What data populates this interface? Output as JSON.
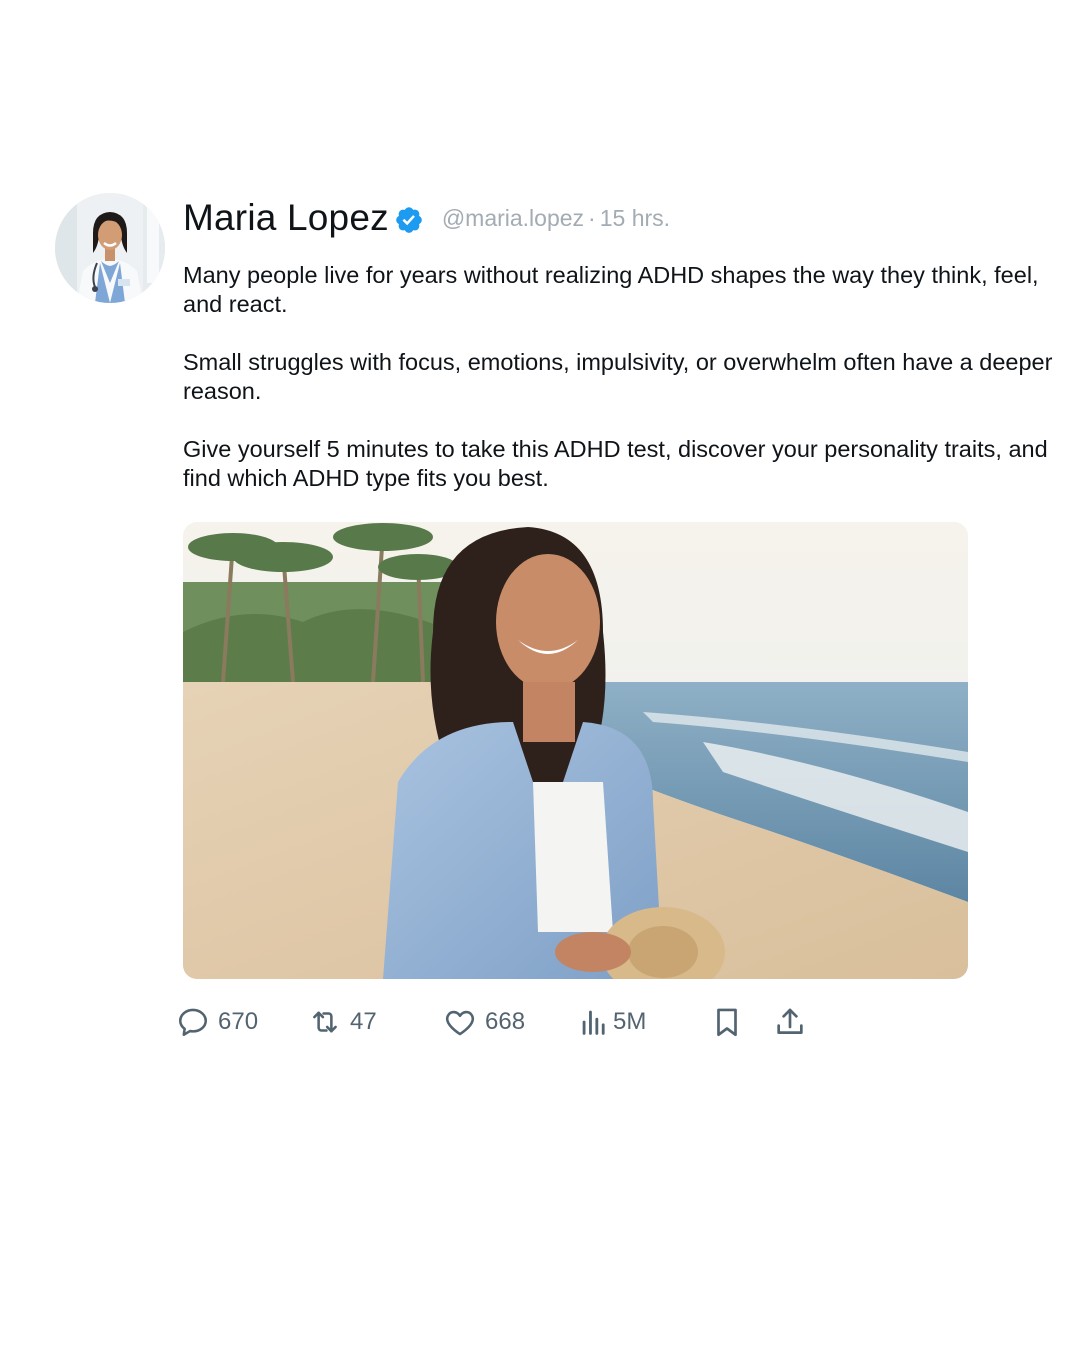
{
  "post": {
    "author_name": "Maria Lopez",
    "handle": "@maria.lopez",
    "separator": "·",
    "time": "15 hrs.",
    "paragraphs": [
      "Many people live for years without realizing ADHD shapes the way they think, feel, and react.",
      "Small struggles with focus, emotions, impulsivity, or overwhelm often have a deeper reason.",
      "Give yourself 5 minutes to take this ADHD test, discover your personality traits, and find which ADHD type fits you best."
    ]
  },
  "actions": {
    "replies": "670",
    "reposts": "47",
    "likes": "668",
    "views": "5M"
  },
  "icons": {
    "verified": "verified-badge-icon",
    "reply": "reply-icon",
    "repost": "repost-icon",
    "like": "heart-icon",
    "views": "views-icon",
    "bookmark": "bookmark-icon",
    "share": "share-icon"
  },
  "colors": {
    "verified_blue": "#1d9bf0",
    "text": "#0f1419",
    "muted": "#a3abb3",
    "action_gray": "#536471"
  }
}
